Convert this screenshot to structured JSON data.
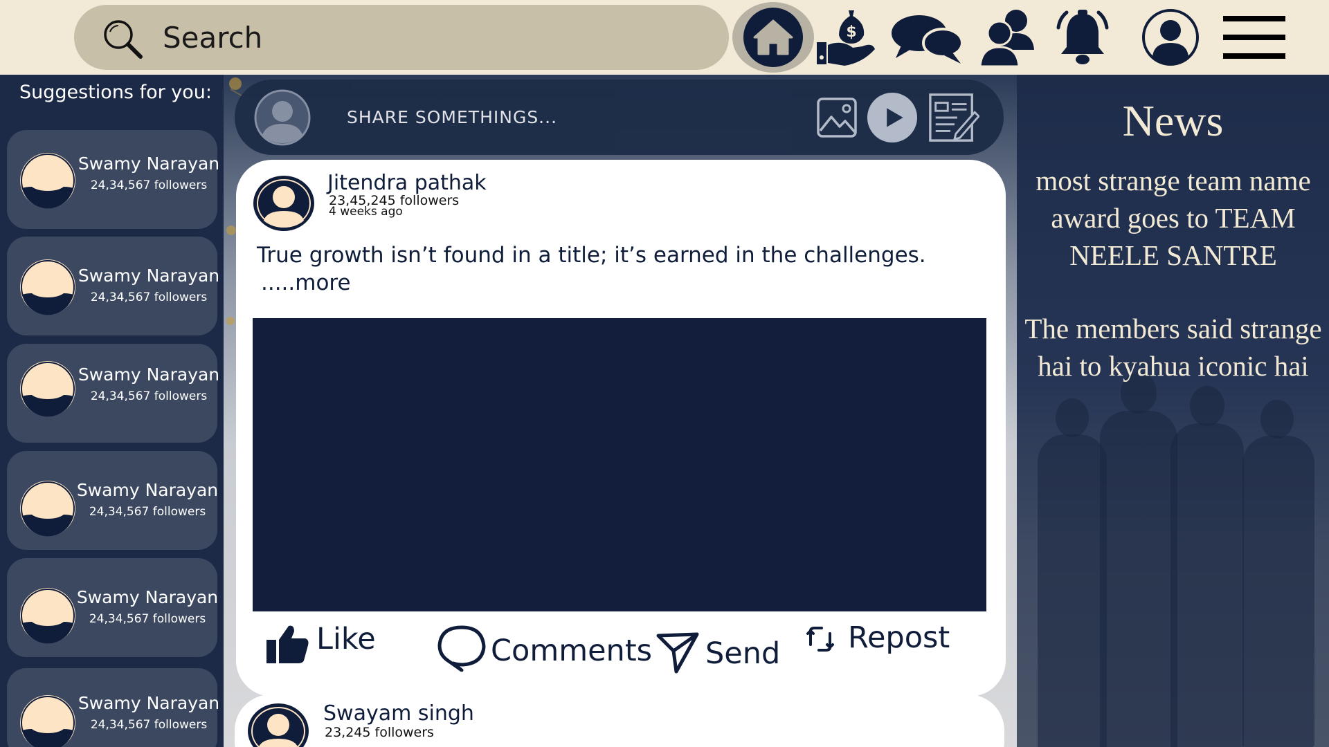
{
  "topbar": {
    "search_placeholder": "Search",
    "nav_icons": [
      "home-icon",
      "money-icon",
      "chat-icon",
      "people-icon",
      "bell-icon",
      "profile-icon",
      "menu-icon"
    ],
    "active_nav": "home"
  },
  "sidebar": {
    "heading": "Suggestions for you:",
    "suggestions": [
      {
        "name": "Swamy Narayan",
        "followers": "24,34,567 followers"
      },
      {
        "name": "Swamy Narayan",
        "followers": "24,34,567 followers"
      },
      {
        "name": "Swamy Narayan",
        "followers": "24,34,567 followers"
      },
      {
        "name": "Swamy Narayan",
        "followers": "24,34,567 followers"
      },
      {
        "name": "Swamy Narayan",
        "followers": "24,34,567 followers"
      },
      {
        "name": "Swamy Narayan",
        "followers": "24,34,567 followers"
      }
    ]
  },
  "composer": {
    "placeholder": "SHARE SOMETHINGS..."
  },
  "posts": [
    {
      "author": "Jitendra pathak",
      "followers": "23,45,245 followers",
      "time": "4 weeks ago",
      "text": "True growth isn’t found in a title; it’s earned in the challenges.",
      "more": ".....more",
      "actions": {
        "like": "Like",
        "comments": "Comments",
        "send": "Send",
        "repost": "Repost"
      }
    },
    {
      "author": "Swayam singh",
      "followers": "23,245 followers"
    }
  ],
  "news": {
    "title": "News",
    "items": [
      "most strange team name award goes    to TEAM NEELE SANTRE",
      "The members said strange hai to kyahua iconic hai"
    ]
  },
  "colors": {
    "navy": "#0f1d3a",
    "cream": "#f2ead7",
    "search_bg": "#c8bfa8",
    "card_bg": "#3b4860",
    "avatar_skin": "#fde4c4"
  }
}
